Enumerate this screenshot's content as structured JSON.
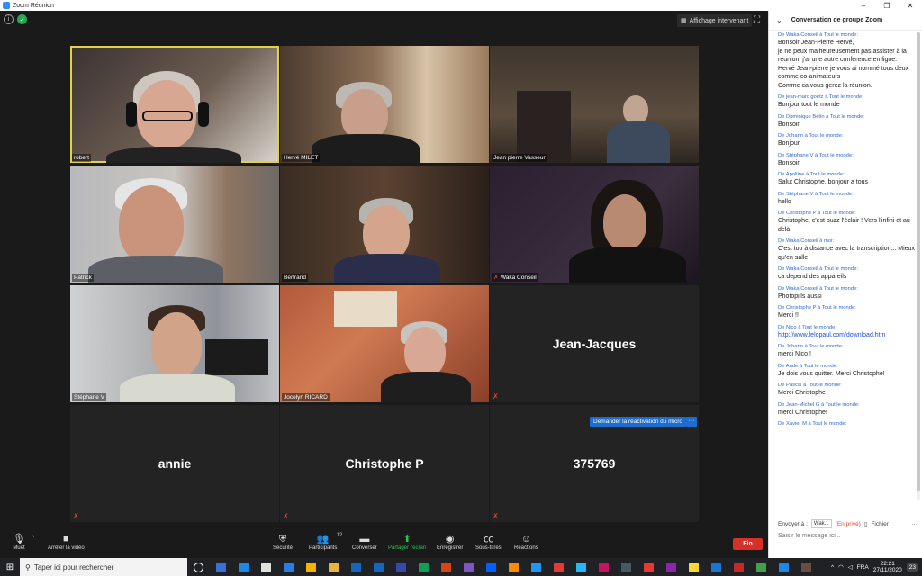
{
  "window": {
    "title": "Zoom Réunion",
    "controls": [
      "–",
      "❐",
      "✕"
    ]
  },
  "view": {
    "speaker_view_label": "Affichage intervenant"
  },
  "participants": [
    {
      "name": "robert",
      "muted": false,
      "active": true,
      "video": true
    },
    {
      "name": "Hervé MILET",
      "muted": false,
      "video": true
    },
    {
      "name": "Jean pierre Vasseur",
      "muted": false,
      "video": true
    },
    {
      "name": "Patrick",
      "muted": false,
      "video": true
    },
    {
      "name": "Bertrand",
      "muted": false,
      "video": true
    },
    {
      "name": "Waka Conseil",
      "muted": true,
      "video": true
    },
    {
      "name": "Stéphane V",
      "muted": false,
      "video": true
    },
    {
      "name": "Jocelyn RICARD",
      "muted": false,
      "video": true
    },
    {
      "name": "Jean-Jacques",
      "muted": true,
      "video": false
    },
    {
      "name": "annie",
      "muted": true,
      "video": false
    },
    {
      "name": "Christophe P",
      "muted": true,
      "video": false
    },
    {
      "name": "375769",
      "muted": true,
      "video": false
    }
  ],
  "unmute_request_label": "Demander la réactivation du micro",
  "more_label": "···",
  "toolbar": {
    "mute": "Muet",
    "stop_video": "Arrêter la vidéo",
    "security": "Sécurité",
    "participants": "Participants",
    "participants_count": "12",
    "chat": "Converser",
    "share": "Partager l'écran",
    "record": "Enregistrer",
    "subtitles": "Sous-titres",
    "reactions": "Réactions",
    "end": "Fin"
  },
  "chat": {
    "title": "Conversation de groupe Zoom",
    "messages": [
      {
        "from": "De Waka Conseil à Tout le monde:",
        "text": "Bonsoir Jean-Pierre Hervé,\nje ne peux malheureusement pas assister à la réunion, j'ai une autre conférence en ligne.\nHervé Jean-pierre je vous ai nommé tous deux comme co-animateurs\nComme ca vous gerez la réunion."
      },
      {
        "from": "De jean-marc goetz à Tout le monde:",
        "text": "Bonjour tout le monde"
      },
      {
        "from": "De Dominique Bétin à Tout le monde:",
        "text": "Bonsoir"
      },
      {
        "from": "De Johann à Tout le monde:",
        "text": "Bonjour"
      },
      {
        "from": "De Stéphane V à Tout le monde:",
        "text": "Bonsoir."
      },
      {
        "from": "De Apolline à Tout le monde:",
        "text": "Salut Christophe, bonjour  a tous"
      },
      {
        "from": "De Stéphane V à Tout le monde:",
        "text": "hello"
      },
      {
        "from": "De Christophe P à Tout le monde:",
        "text": "Christophe, c'est buzz l'éclair ! Vers l'infini et au delà"
      },
      {
        "from": "De Waka Conseil à moi:",
        "private": "(En privé)",
        "text": "C'est top à distance avec la transcription... Mieux qu'en salle"
      },
      {
        "from": "De Waka Conseil à Tout le monde:",
        "text": "ca depend des appareils"
      },
      {
        "from": "De Waka Conseil à Tout le monde:",
        "text": "Photopills aussi"
      },
      {
        "from": "De Christophe P à Tout le monde:",
        "text": "Merci !!"
      },
      {
        "from": "De Nico à Tout le monde:",
        "link": "http://www.felopaul.com/download.htm"
      },
      {
        "from": "De Johann à Tout le monde:",
        "text": "merci Nico !"
      },
      {
        "from": "De Aude à Tout le monde:",
        "text": "Je dois vous quitter. Merci Christophe!"
      },
      {
        "from": "De Pascal à Tout le monde:",
        "text": "Merci Christophe"
      },
      {
        "from": "De Jean-Michel G à Tout le monde:",
        "text": "merci Christophe!"
      },
      {
        "from": "De Xavier M à Tout le monde:",
        "text": ""
      }
    ],
    "send_to_label": "Envoyer à :",
    "send_to_value": "Wak...",
    "private_label": "(En privé)",
    "file_label": "Fichier",
    "input_placeholder": "Saisir le message ici..."
  },
  "taskbar": {
    "search_placeholder": "Taper ici pour rechercher",
    "language": "FRA",
    "time": "22:21",
    "date": "27/11/2020",
    "notification_count": "23"
  },
  "colors": {
    "accent": "#2d8cff",
    "end": "#d6302a",
    "active_border": "#e0d34a",
    "mute": "#e0463a"
  }
}
